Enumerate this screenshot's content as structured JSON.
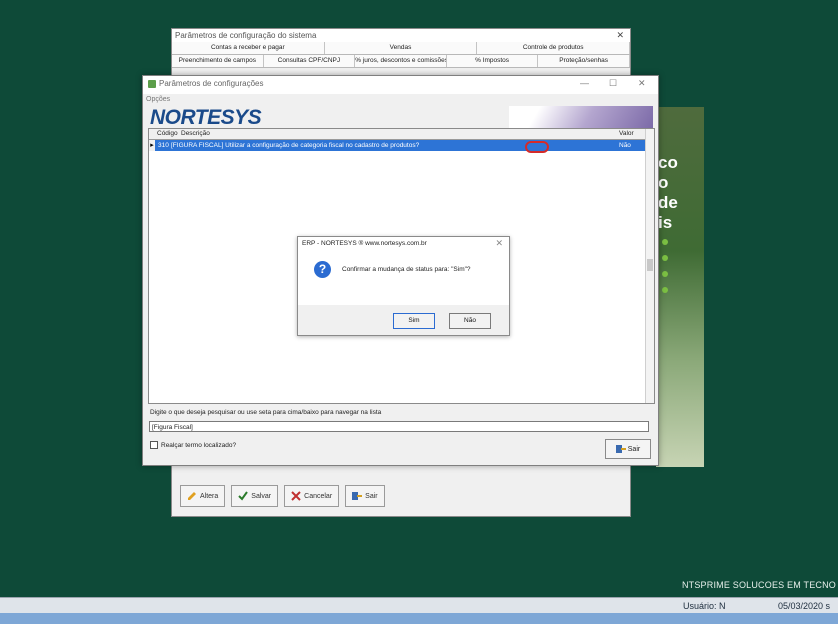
{
  "back_window": {
    "title": "Parâmetros de configuração do sistema",
    "tabs_row1": [
      "Contas a receber e pagar",
      "Vendas",
      "Controle de produtos"
    ],
    "tabs_row2": [
      "Preenchimento de campos",
      "Consultas CPF/CNPJ",
      "% juros, descontos e comissões",
      "% Impostos",
      "Proteção/senhas"
    ],
    "toolbar": {
      "alterar": "Altera",
      "salvar": "Salvar",
      "cancelar": "Cancelar",
      "sair": "Sair"
    }
  },
  "main_window": {
    "title": "Parâmetros de configurações",
    "opcoes_label": "Opções",
    "logo": "NORTESYS",
    "grid": {
      "columns": {
        "codigo": "Código",
        "descricao": "Descrição",
        "valor": "Valor"
      },
      "selected_row": {
        "code": "310",
        "description": "[FIGURA FISCAL] Utilizar a configuração de categoria fiscal no cadastro de produtos?",
        "value": "Não"
      }
    },
    "search_label": "Digite o que deseja pesquisar ou use seta para cima/baixo para navegar na lista",
    "search_value": "[Figura Fiscal]",
    "checkbox_label": "Realçar termo localizado?",
    "sair_label": "Sair"
  },
  "dialog": {
    "title": "ERP - NORTESYS ® www.nortesys.com.br",
    "message": "Confirmar a mudança de status para: \"Sim\"?",
    "yes": "Sim",
    "no": "Não"
  },
  "promo_letters": "co\no\nde\nis",
  "brand": "NTSPRIME SOLUCOES EM TECNO",
  "status": {
    "user": "Usuário: N",
    "date": "05/03/2020 s"
  },
  "colors": {
    "desktop": "#0e4a38",
    "selection": "#2d74d6",
    "logo": "#1a4a8a"
  }
}
